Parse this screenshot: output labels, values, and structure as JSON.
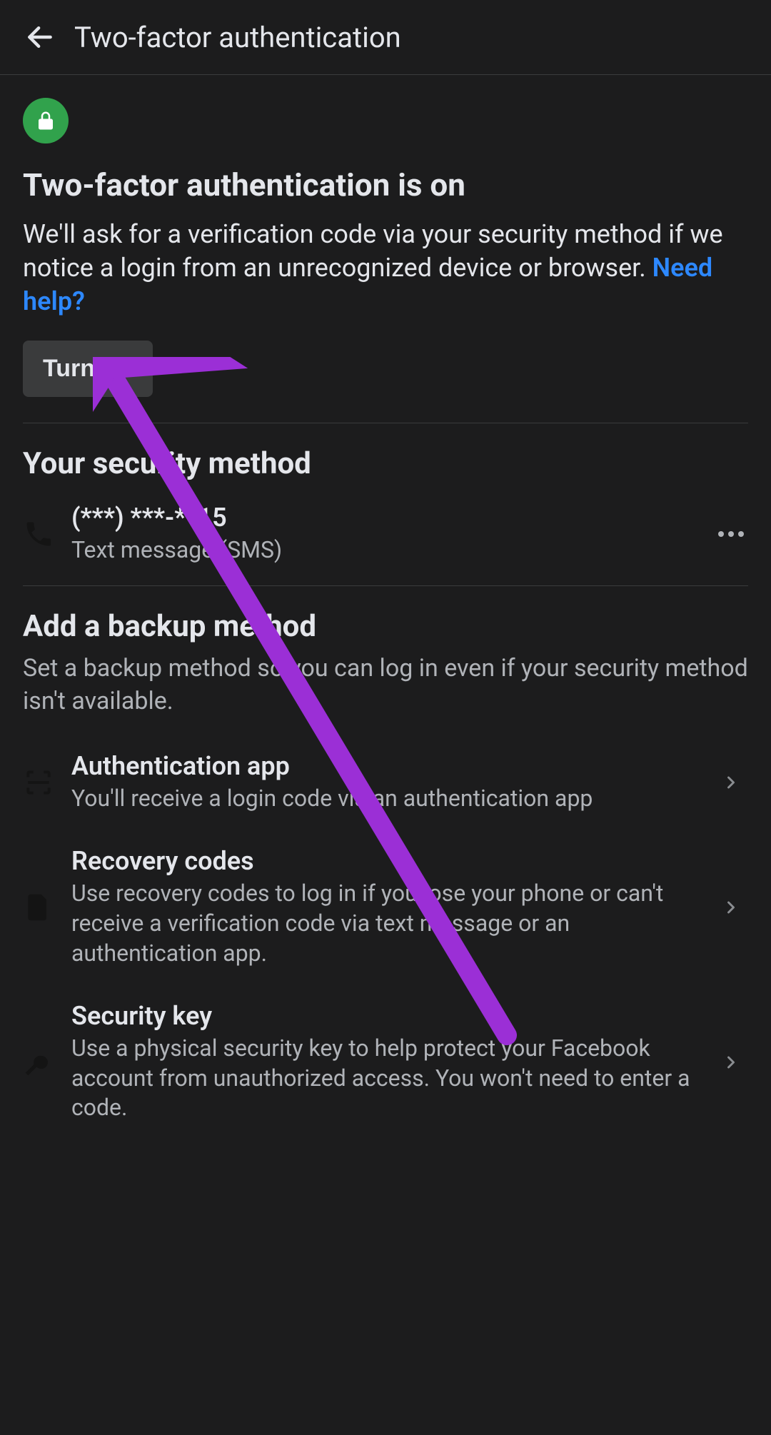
{
  "header": {
    "title": "Two-factor authentication"
  },
  "status": {
    "title": "Two-factor authentication is on",
    "description": "We'll ask for a verification code via your security method if we notice a login from an unrecognized device or browser. ",
    "help_link": "Need help?",
    "turn_off_label": "Turn off"
  },
  "security_method": {
    "heading": "Your security method",
    "phone_masked": "(***) ***-**15",
    "phone_sub": "Text message (SMS)"
  },
  "backup": {
    "heading": "Add a backup method",
    "description": "Set a backup method so you can log in even if your security method isn't available.",
    "items": [
      {
        "title": "Authentication app",
        "sub": "You'll receive a login code via an authentication app"
      },
      {
        "title": "Recovery codes",
        "sub": "Use recovery codes to log in if you lose your phone or can't receive a verification code via text message or an authentication app."
      },
      {
        "title": "Security key",
        "sub": "Use a physical security key to help protect your Facebook account from unauthorized access. You won't need to enter a code."
      }
    ]
  }
}
